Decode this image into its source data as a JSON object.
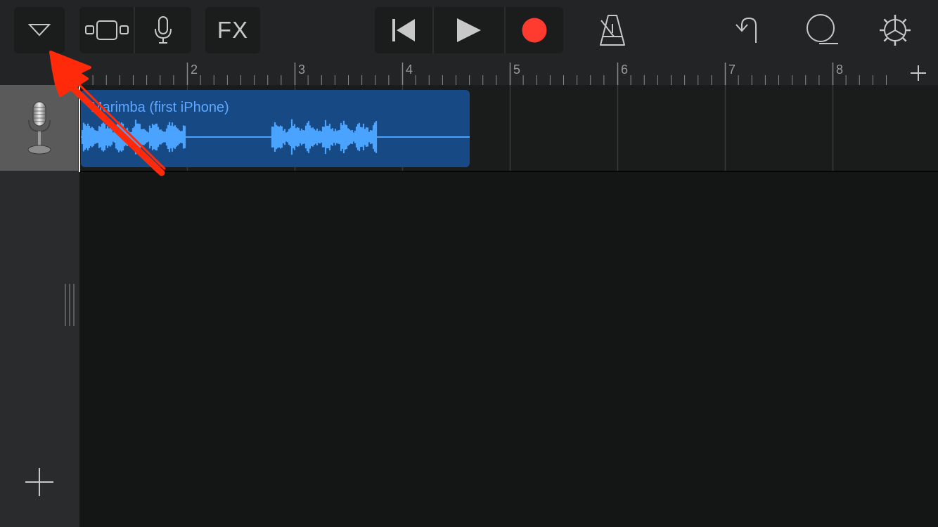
{
  "toolbar": {
    "fx_label": "FX"
  },
  "ruler": {
    "bars": [
      "2",
      "3",
      "4",
      "5",
      "6",
      "7",
      "8"
    ]
  },
  "track": {
    "region_name": "Marimba (first iPhone)",
    "instrument": "microphone-icon"
  },
  "icons": {
    "browser": "chevron-down-icon",
    "tracks_view": "tracks-view-icon",
    "audio_input": "microphone-icon",
    "go_to_start": "go-to-start-icon",
    "play": "play-icon",
    "record": "record-icon",
    "metronome": "metronome-icon",
    "undo": "undo-icon",
    "loop": "loop-icon",
    "settings": "gear-icon",
    "add_section": "plus-icon",
    "add_track": "plus-icon",
    "annotation": "red-arrow-annotation"
  },
  "colors": {
    "record": "#ff3b30",
    "region": "#174a84",
    "waveform": "#4aa3ff",
    "annotation": "#ff2a0a"
  }
}
